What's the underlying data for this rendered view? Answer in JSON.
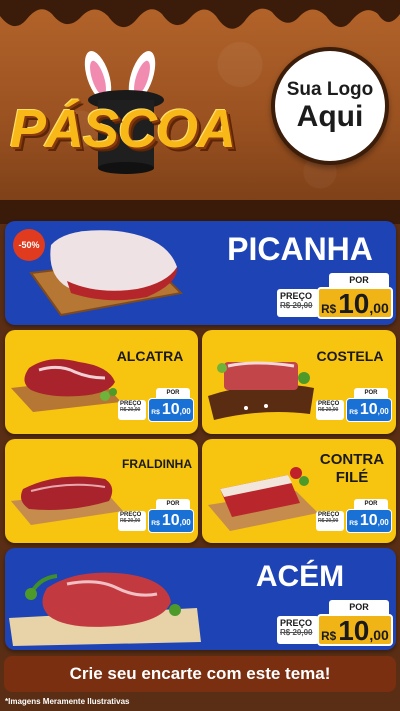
{
  "header": {
    "title": "PÁSCOA",
    "logo_line1": "Sua Logo",
    "logo_line2": "Aqui"
  },
  "products": [
    {
      "name": "PICANHA",
      "badge": "-50%",
      "label_por": "POR",
      "label_preco": "PREÇO",
      "old_price": "R$ 20,00",
      "currency": "R$",
      "price_int": "10",
      "price_cents": ",00"
    },
    {
      "name": "ALCATRA",
      "label_por": "POR",
      "label_preco": "PREÇO",
      "old_price": "R$ 20,00",
      "currency": "R$",
      "price_int": "10",
      "price_cents": ",00"
    },
    {
      "name": "COSTELA",
      "label_por": "POR",
      "label_preco": "PREÇO",
      "old_price": "R$ 20,00",
      "currency": "R$",
      "price_int": "10",
      "price_cents": ",00"
    },
    {
      "name": "FRALDINHA",
      "label_por": "POR",
      "label_preco": "PREÇO",
      "old_price": "R$ 20,00",
      "currency": "R$",
      "price_int": "10",
      "price_cents": ",00"
    },
    {
      "name_line1": "CONTRA",
      "name_line2": "FILÉ",
      "label_por": "POR",
      "label_preco": "PREÇO",
      "old_price": "R$ 20,00",
      "currency": "R$",
      "price_int": "10",
      "price_cents": ",00"
    },
    {
      "name": "ACÉM",
      "label_por": "POR",
      "label_preco": "PREÇO",
      "old_price": "R$ 20,00",
      "currency": "R$",
      "price_int": "10",
      "price_cents": ",00"
    }
  ],
  "footer": {
    "banner": "Crie seu encarte com este tema!",
    "note": "*Imagens Meramente Ilustrativas"
  },
  "colors": {
    "header_brown": "#9b5221",
    "blue_card": "#1d43b5",
    "yellow_card": "#f7c40f",
    "price_gold": "#f0b417",
    "price_blue": "#1971d6",
    "footer_banner": "#7a2f10"
  }
}
